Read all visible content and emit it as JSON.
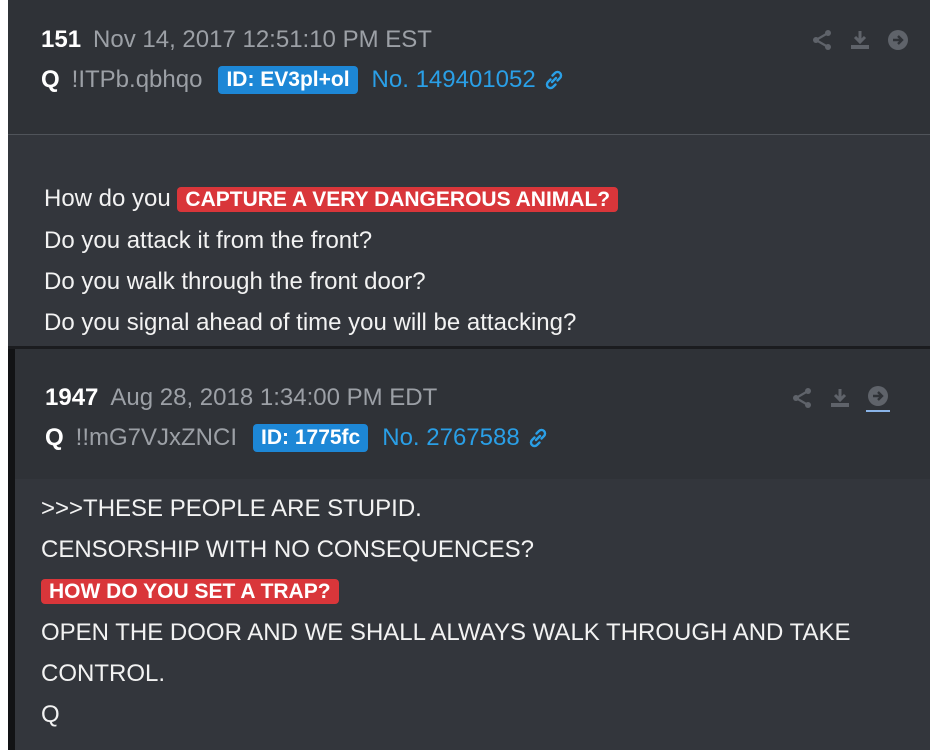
{
  "posts": [
    {
      "number": "151",
      "date": "Nov 14, 2017 12:51:10 PM EST",
      "author": "Q",
      "tripcode": "!ITPb.qbhqo",
      "id_badge": "ID: EV3pl+ol",
      "post_no": "No. 149401052",
      "lines": {
        "line1_prefix": "How do you",
        "line1_highlight": "CAPTURE A VERY DANGEROUS ANIMAL?",
        "line2": "Do you attack it from the front?",
        "line3": "Do you walk through the front door?",
        "line4": "Do you signal ahead of time you will be attacking?"
      }
    },
    {
      "number": "1947",
      "date": "Aug 28, 2018 1:34:00 PM EDT",
      "author": "Q",
      "tripcode": "!!mG7VJxZNCI",
      "id_badge": "ID: 1775fc",
      "post_no": "No. 2767588",
      "lines": {
        "line1": ">>>THESE PEOPLE ARE STUPID.",
        "line2": "CENSORSHIP WITH NO CONSEQUENCES?",
        "line3_highlight": "HOW DO YOU SET A TRAP?",
        "line4": "OPEN THE DOOR AND WE SHALL ALWAYS WALK THROUGH AND TAKE",
        "line5": "CONTROL.",
        "line6": "Q"
      }
    }
  ],
  "icons": [
    "share-icon",
    "download-icon",
    "goto-icon",
    "link-icon"
  ],
  "colors": {
    "background": "#33363c",
    "header": "#2f3237",
    "id_badge": "#1d87d6",
    "post_link": "#2a9fe6",
    "highlight": "#d9363a"
  }
}
